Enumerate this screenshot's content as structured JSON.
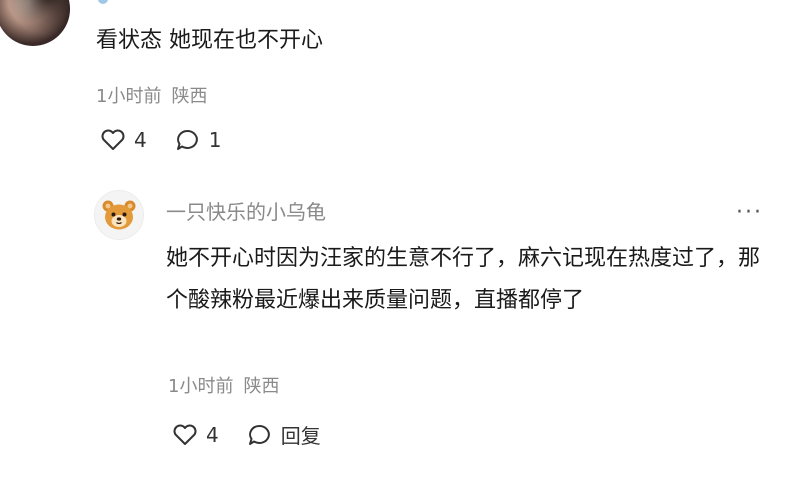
{
  "comment": {
    "text": "看状态 她现在也不开心",
    "time": "1小时前",
    "location": "陕西",
    "like_count": "4",
    "reply_count": "1"
  },
  "reply": {
    "username": "一只快乐的小乌龟",
    "more": "···",
    "text": "她不开心时因为汪家的生意不行了，麻六记现在热度过了，那个酸辣粉最近爆出来质量问题，直播都停了",
    "time": "1小时前",
    "location": "陕西",
    "like_count": "4",
    "reply_label": "回复"
  }
}
